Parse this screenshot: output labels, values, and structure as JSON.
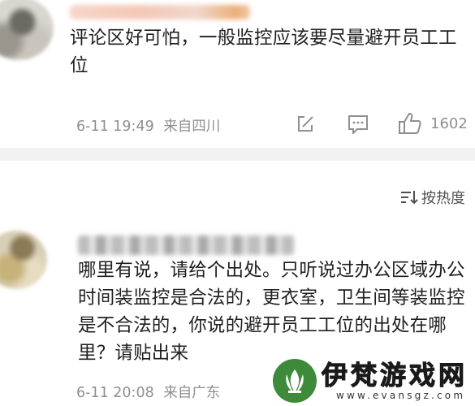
{
  "comments": [
    {
      "text": "评论区好可怕，一般监控应该要尽量避开员工工位",
      "date": "6-11 19:49",
      "location": "来自四川",
      "likes": "1602"
    },
    {
      "text": "哪里有说，请给个出处。只听说过办公区域办公时间装监控是合法的，更衣室，卫生间等装监控是不合法的，你说的避开员工工位的出处在哪里？请贴出来",
      "date": "6-11 20:08",
      "location": "来自广东"
    }
  ],
  "sort": {
    "label": "按热度",
    "icon": "sort-icon"
  },
  "watermark": {
    "title": "伊梵游戏网",
    "url": "www.evansgz.com"
  },
  "colors": {
    "meta_gray": "#8f8f8f",
    "divider": "#f2f2f2",
    "brand_green": "#3c8a3a"
  }
}
